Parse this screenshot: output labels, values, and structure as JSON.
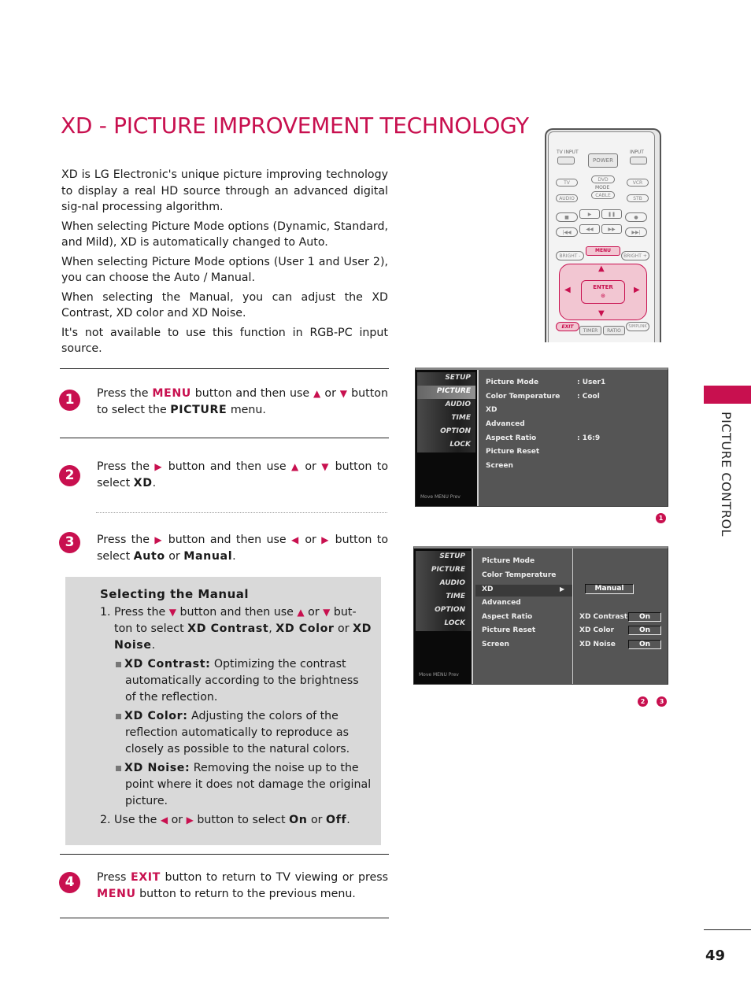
{
  "page": {
    "title": "XD - PICTURE IMPROVEMENT TECHNOLOGY",
    "section_label": "PICTURE CONTROL",
    "page_number": "49",
    "accent_color": "#c8104f"
  },
  "intro": [
    "XD is LG Electronic's unique picture improving technology to display a real HD source through an advanced digital sig-nal processing algorithm.",
    "When selecting Picture Mode options (Dynamic, Standard, and Mild), XD is automatically changed to Auto.",
    "When selecting Picture Mode options (User 1 and User 2), you can choose the Auto / Manual.",
    "When selecting the Manual, you can adjust the XD Contrast, XD color and XD Noise.",
    "It's not available to use this function in RGB-PC input source."
  ],
  "steps": {
    "s1": {
      "num": "1",
      "a": "Press the ",
      "menu": "MENU",
      "b": " button and then use ",
      "up": "▲",
      "or": " or ",
      "down": "▼",
      "c": " button to select the ",
      "picture": "PICTURE",
      "d": " menu."
    },
    "s2": {
      "num": "2",
      "a": "Press the ",
      "right": "▶",
      "b": " button and then use ",
      "up": "▲",
      "or": " or ",
      "down": "▼",
      "c": " button to select ",
      "xd": "XD",
      "d": "."
    },
    "s3": {
      "num": "3",
      "a": "Press the ",
      "right": "▶",
      "b": " button and then use ",
      "left": "◀",
      "or": " or ",
      "right2": "▶",
      "c": " button to select ",
      "auto": "Auto",
      "or2": " or ",
      "manual": "Manual",
      "d": "."
    },
    "s4": {
      "num": "4",
      "a": "Press ",
      "exit": "EXIT",
      "b": " button to return to TV viewing or press ",
      "menu": "MENU",
      "c": " button to return to the previous menu."
    }
  },
  "manual_box": {
    "title": "Selecting the Manual",
    "item1": {
      "num": "1. ",
      "a": "Press the ",
      "down": "▼",
      "b": " button and then use ",
      "up": "▲",
      "or": " or ",
      "down2": "▼",
      "c": " but-ton to select ",
      "contrast": "XD Contrast",
      "comma": ", ",
      "color": "XD Color",
      "or2": " or ",
      "noise": "XD Noise",
      "d": "."
    },
    "bullets": [
      {
        "term": "XD Contrast:",
        "desc": " Optimizing the contrast automatically according to the brightness of the reflection."
      },
      {
        "term": "XD Color:",
        "desc": " Adjusting the colors of the reflection automatically to reproduce as closely as possible to the natural colors."
      },
      {
        "term": "XD Noise:",
        "desc": " Removing the noise up to the point where it does not damage the original picture."
      }
    ],
    "item2": {
      "num": "2. ",
      "a": "Use the ",
      "left": "◀",
      "or": " or ",
      "right": "▶",
      "b": " button to select ",
      "on": "On",
      "or2": " or ",
      "off": "Off",
      "c": "."
    }
  },
  "remote": {
    "tv_input": "TV INPUT",
    "power": "POWER",
    "input": "INPUT",
    "tv": "TV",
    "dvd": "DVD",
    "vcr": "VCR",
    "mode": "MODE",
    "audio": "AUDIO",
    "cable": "CABLE",
    "stb": "STB",
    "stop": "■",
    "play": "▶",
    "pause": "❚❚",
    "rec": "●",
    "prev": "|◀◀",
    "rew": "◀◀",
    "ff": "▶▶",
    "next": "▶▶|",
    "bright_minus": "BRIGHT -",
    "menu": "MENU",
    "bright_plus": "BRIGHT +",
    "up": "▲",
    "down": "▼",
    "left": "◀",
    "right": "▶",
    "enter": "ENTER",
    "enter_dot": "⊙",
    "exit": "EXIT",
    "timer": "TIMER",
    "ratio": "RATIO",
    "simplink": "SIMPLINK"
  },
  "osd1": {
    "categories": [
      "SETUP",
      "PICTURE",
      "AUDIO",
      "TIME",
      "OPTION",
      "LOCK"
    ],
    "footer": "Move  MENU Prev",
    "items": [
      {
        "label": "Picture Mode",
        "value": ": User1"
      },
      {
        "label": "Color Temperature",
        "value": ": Cool"
      },
      {
        "label": "XD",
        "value": ""
      },
      {
        "label": "Advanced",
        "value": ""
      },
      {
        "label": "Aspect Ratio",
        "value": ": 16:9"
      },
      {
        "label": "Picture Reset",
        "value": ""
      },
      {
        "label": "Screen",
        "value": ""
      }
    ],
    "badge": "1"
  },
  "osd2": {
    "categories": [
      "SETUP",
      "PICTURE",
      "AUDIO",
      "TIME",
      "OPTION",
      "LOCK"
    ],
    "footer": "Move  MENU Prev",
    "items": [
      "Picture Mode",
      "Color Temperature",
      "XD",
      "Advanced",
      "Aspect Ratio",
      "Picture Reset",
      "Screen"
    ],
    "selected_arrow": "▶",
    "mode_value": "Manual",
    "sub": [
      {
        "label": "XD Contrast",
        "value": "On"
      },
      {
        "label": "XD Color",
        "value": "On"
      },
      {
        "label": "XD Noise",
        "value": "On"
      }
    ],
    "badges": [
      "2",
      "3"
    ]
  }
}
